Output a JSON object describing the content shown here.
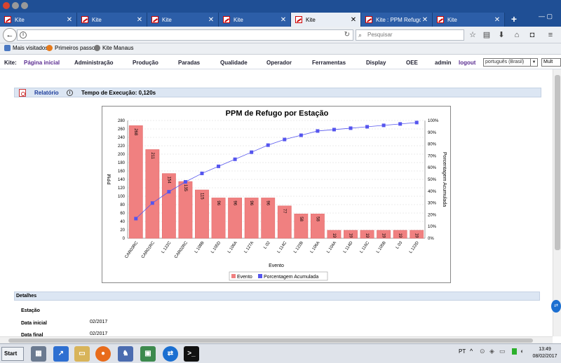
{
  "browser": {
    "tabs": [
      {
        "label": "Kite"
      },
      {
        "label": "Kite"
      },
      {
        "label": "Kite"
      },
      {
        "label": "Kite"
      },
      {
        "label": "Kite"
      },
      {
        "label": "Kite : PPM Refugo"
      },
      {
        "label": "Kite"
      }
    ],
    "new_tab_label": "+",
    "url": "",
    "search_placeholder": "Pesquisar",
    "bookmarks": [
      {
        "label": "Mais visitados",
        "icon": "bookmark-icon"
      },
      {
        "label": "Primeiros passos",
        "icon": "firefox-icon"
      },
      {
        "label": "Kite Manaus",
        "icon": "globe-icon"
      }
    ]
  },
  "app_menu": {
    "brand": "Kite:",
    "items": [
      {
        "label": "Página inicial"
      },
      {
        "label": "Administração"
      },
      {
        "label": "Produção"
      },
      {
        "label": "Paradas"
      },
      {
        "label": "Qualidade"
      },
      {
        "label": "Operador"
      },
      {
        "label": "Ferramentas"
      },
      {
        "label": "Display"
      },
      {
        "label": "OEE"
      },
      {
        "label": "admin"
      },
      {
        "label": "logout"
      }
    ],
    "language": "português (Brasil)",
    "extra": "Mult"
  },
  "report": {
    "link_label": "Relatório",
    "exec_time": "Tempo de Execução: 0,120s"
  },
  "chart_data": {
    "type": "bar",
    "title": "PPM de Refugo por Estação",
    "xlabel": "Evento",
    "ylabel": "PPM",
    "ylabel_right": "Porcentagem Acumulada",
    "ylim": [
      0,
      280
    ],
    "yticks": [
      0,
      20,
      40,
      60,
      80,
      100,
      120,
      140,
      160,
      180,
      200,
      220,
      240,
      260,
      280
    ],
    "y2lim": [
      0,
      100
    ],
    "y2ticks": [
      "0%",
      "10%",
      "20%",
      "30%",
      "40%",
      "50%",
      "60%",
      "70%",
      "80%",
      "90%",
      "100%"
    ],
    "categories": [
      "CAR03RC",
      "CAR01RC",
      "L 122C",
      "CAR02RC",
      "L 108B",
      "L 105D",
      "L 106A",
      "L 127A",
      "L 02",
      "L 114C",
      "L 122B",
      "L 106A",
      "L 104A",
      "L 114D",
      "L 116C",
      "L 105B",
      "L 03",
      "L 122D"
    ],
    "series": [
      {
        "name": "Evento",
        "type": "bar",
        "color": "#f08080",
        "values": [
          268,
          211,
          154,
          135,
          115,
          96,
          96,
          96,
          96,
          77,
          58,
          58,
          19,
          19,
          19,
          19,
          19,
          19
        ],
        "labels": [
          "268",
          "211",
          "154",
          "135",
          "115",
          "96",
          "96",
          "96",
          "96",
          "77",
          "58",
          "58",
          "19",
          "19",
          "19",
          "19",
          "19",
          "19"
        ]
      },
      {
        "name": "Porcentagem Acumulada",
        "type": "line",
        "color": "#5555ee",
        "values": [
          16.7,
          29.9,
          39.5,
          47.9,
          55.1,
          61.1,
          67.1,
          73.1,
          79.1,
          83.9,
          87.5,
          91.1,
          92.3,
          93.5,
          94.7,
          95.9,
          97.1,
          98.3
        ]
      }
    ],
    "legend": "bottom",
    "grid": true
  },
  "details": {
    "header": "Detalhes",
    "rows": [
      {
        "label": "Estação",
        "value": ""
      },
      {
        "label": "Data inicial",
        "value": "02/2017"
      },
      {
        "label": "Data final",
        "value": "02/2017"
      }
    ]
  },
  "taskbar": {
    "start_label": "Start",
    "lang": "PT",
    "time": "13:49",
    "date": "08/02/2017"
  }
}
